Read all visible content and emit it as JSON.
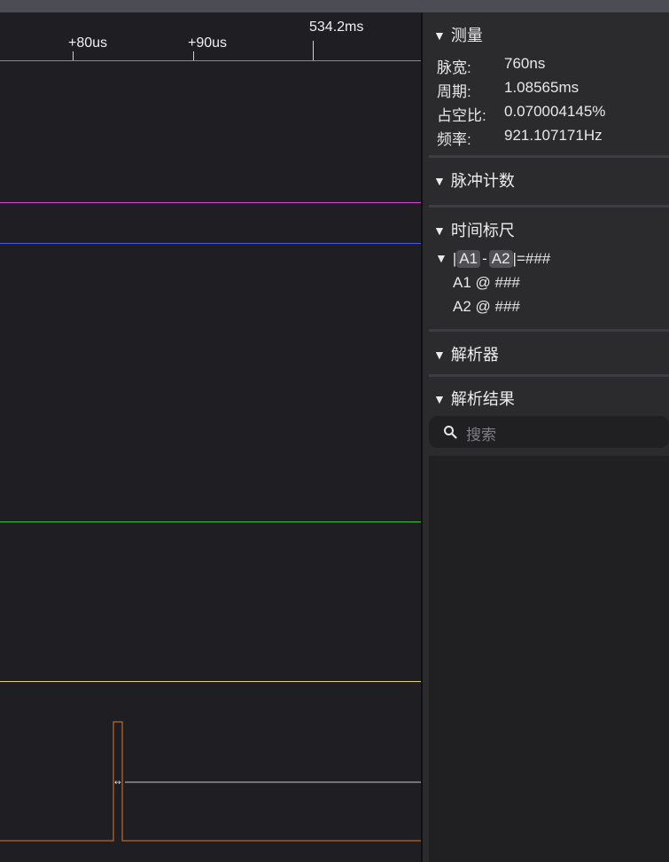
{
  "timeline": {
    "ticks": [
      "+80us",
      "+90us",
      "534.2ms"
    ]
  },
  "sections": {
    "measure_title": "测量",
    "measurements": [
      {
        "label": "脉宽:",
        "value": "760ns"
      },
      {
        "label": "周期:",
        "value": "1.08565ms"
      },
      {
        "label": "占空比:",
        "value": "0.070004145%"
      },
      {
        "label": "频率:",
        "value": "921.107171Hz"
      }
    ],
    "pulse_count_title": "脉冲计数",
    "time_ruler_title": "时间标尺",
    "ruler": {
      "bar": "|",
      "a1": "A1",
      "minus": "-",
      "a2": "A2",
      "eq": "|=###",
      "a1_row": "A1 @ ###",
      "a2_row": "A2 @ ###"
    },
    "parser_title": "解析器",
    "results_title": "解析结果"
  },
  "search": {
    "placeholder": "搜索"
  },
  "colors": {
    "magenta": "#d63fd6",
    "blue": "#4a5ce0",
    "green": "#3bc03b",
    "yellow": "#e6d44a",
    "orange": "#e07a2a",
    "measure_line": "#c8c8c8"
  }
}
